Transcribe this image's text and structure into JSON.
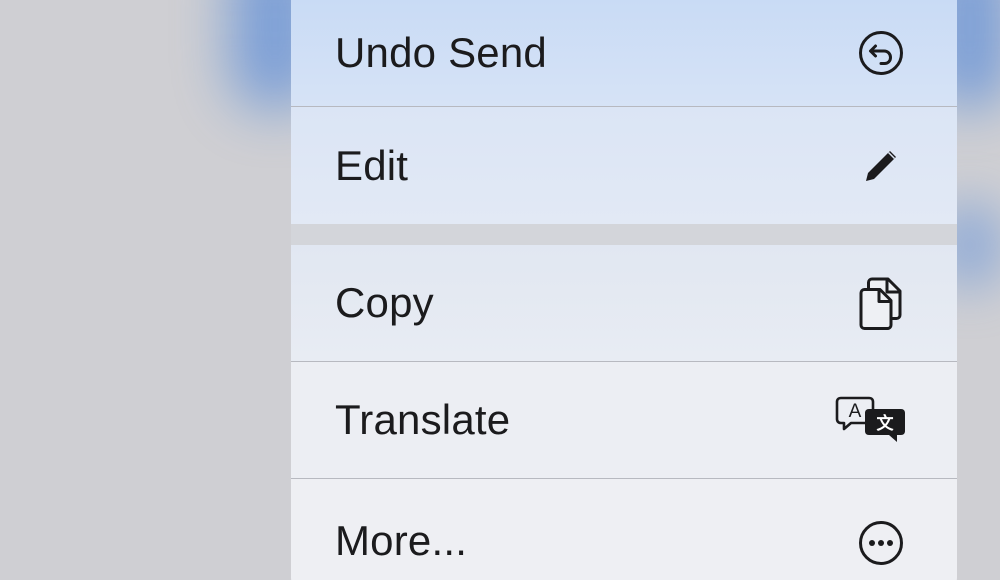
{
  "context_menu": {
    "items": [
      {
        "label": "Undo Send",
        "icon": "undo-arrow-circle-icon"
      },
      {
        "label": "Edit",
        "icon": "pencil-icon"
      },
      {
        "label": "Copy",
        "icon": "copy-documents-icon"
      },
      {
        "label": "Translate",
        "icon": "translate-bubbles-icon"
      },
      {
        "label": "More...",
        "icon": "ellipsis-circle-icon"
      }
    ],
    "translate_icon_glyphs": {
      "latin": "A",
      "other": "文"
    }
  },
  "colors": {
    "label_text": "#1b1b1d",
    "highlight": "#c9dbf5",
    "background": "#cfcfd3",
    "glow": "#5f8fd8"
  }
}
